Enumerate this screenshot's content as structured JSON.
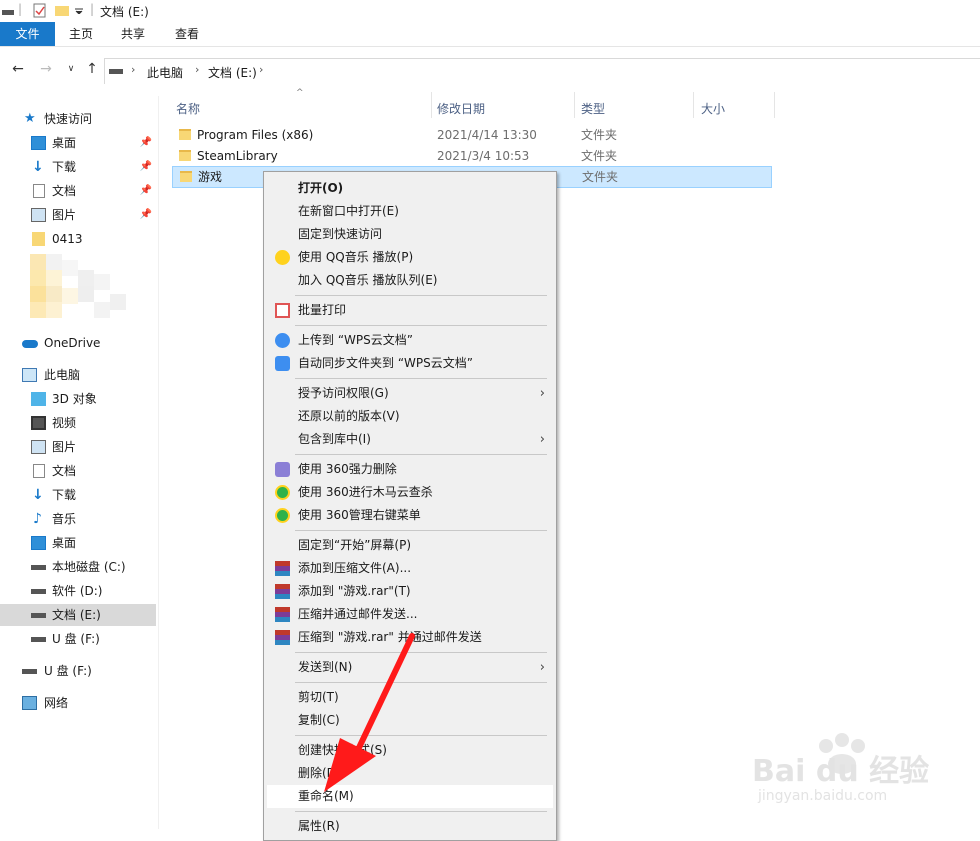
{
  "window": {
    "title": "文档 (E:)"
  },
  "ribbon": {
    "tabs": [
      "文件",
      "主页",
      "共享",
      "查看"
    ]
  },
  "address": {
    "crumbs": [
      "此电脑",
      "文档 (E:)"
    ]
  },
  "nav": {
    "quick_access": "快速访问",
    "quick_items": [
      "桌面",
      "下载",
      "文档",
      "图片",
      "0413"
    ],
    "onedrive": "OneDrive",
    "this_pc": "此电脑",
    "pc_items": [
      "3D 对象",
      "视频",
      "图片",
      "文档",
      "下载",
      "音乐",
      "桌面",
      "本地磁盘 (C:)",
      "软件 (D:)",
      "文档 (E:)",
      "U 盘 (F:)"
    ],
    "usb": "U 盘 (F:)",
    "network": "网络"
  },
  "columns": {
    "name": "名称",
    "date": "修改日期",
    "type": "类型",
    "size": "大小"
  },
  "files": [
    {
      "name": "Program Files (x86)",
      "date": "2021/4/14 13:30",
      "type": "文件夹"
    },
    {
      "name": "SteamLibrary",
      "date": "2021/3/4 10:53",
      "type": "文件夹"
    },
    {
      "name": "游戏",
      "date": "",
      "type": "文件夹"
    }
  ],
  "menu": {
    "open": "打开(O)",
    "open_new_window": "在新窗口中打开(E)",
    "pin_quick": "固定到快速访问",
    "qq_play": "使用 QQ音乐 播放(P)",
    "qq_queue": "加入 QQ音乐 播放队列(E)",
    "batch_print": "批量打印",
    "wps_upload": "上传到 “WPS云文档”",
    "wps_sync": "自动同步文件夹到 “WPS云文档”",
    "grant_access": "授予访问权限(G)",
    "restore": "还原以前的版本(V)",
    "include_lib": "包含到库中(I)",
    "force_delete": "使用 360强力删除",
    "trojan_scan": "使用 360进行木马云查杀",
    "manage_menu": "使用 360管理右键菜单",
    "pin_start": "固定到“开始”屏幕(P)",
    "add_archive": "添加到压缩文件(A)...",
    "add_rar": "添加到 \"游戏.rar\"(T)",
    "compress_mail": "压缩并通过邮件发送...",
    "compress_rar_mail": "压缩到 \"游戏.rar\" 并通过邮件发送",
    "send_to": "发送到(N)",
    "cut": "剪切(T)",
    "copy": "复制(C)",
    "shortcut": "创建快捷方式(S)",
    "delete": "删除(D)",
    "rename": "重命名(M)",
    "properties": "属性(R)"
  },
  "watermark": {
    "brand": "Bai du 经验",
    "url": "jingyan.baidu.com"
  },
  "colors": {
    "accent": "#1979ca",
    "selection": "#cce8ff",
    "arrow": "#ff1a1a"
  }
}
